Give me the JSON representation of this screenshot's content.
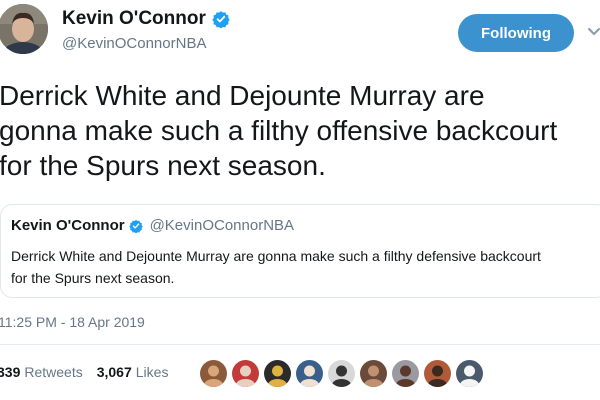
{
  "author": {
    "name": "Kevin O'Connor",
    "handle": "@KevinOConnorNBA",
    "verified": true,
    "avatar_icon": "profile-photo"
  },
  "follow_button": {
    "label": "Following"
  },
  "tweet": {
    "lines": [
      "Derrick White and Dejounte Murray are",
      "gonna make such a filthy offensive backcourt",
      "for the Spurs next season."
    ]
  },
  "quoted_tweet": {
    "name": "Kevin O'Connor",
    "handle": "@KevinOConnorNBA",
    "lines": [
      "Derrick White and Dejounte Murray are gonna make such a filthy defensive backcourt",
      "for the Spurs next season."
    ]
  },
  "timestamp": "11:25 PM - 18 Apr 2019",
  "stats": {
    "retweets_count": "339",
    "retweets_label": "Retweets",
    "likes_count": "3,067",
    "likes_label": "Likes"
  },
  "colors": {
    "accent": "#3b92cf",
    "verified": "#1da1f2",
    "secondary_text": "#657786",
    "border": "#e1e8ed"
  },
  "liker_avatars": [
    {
      "icon": "liker-avatar",
      "bg": "#8a5a3a",
      "fg": "#d9a679"
    },
    {
      "icon": "liker-avatar",
      "bg": "#c23a3a",
      "fg": "#e8d0c0"
    },
    {
      "icon": "liker-avatar",
      "bg": "#2b2b2b",
      "fg": "#e0b040"
    },
    {
      "icon": "liker-avatar",
      "bg": "#3a5f8a",
      "fg": "#f0e0d0"
    },
    {
      "icon": "liker-avatar",
      "bg": "#d8d8d8",
      "fg": "#333333"
    },
    {
      "icon": "liker-avatar",
      "bg": "#6a4a3a",
      "fg": "#c09070"
    },
    {
      "icon": "liker-avatar",
      "bg": "#9a9aa0",
      "fg": "#5a3a2a"
    },
    {
      "icon": "liker-avatar",
      "bg": "#b05a3a",
      "fg": "#3a2a20"
    },
    {
      "icon": "liker-avatar",
      "bg": "#4a5a6a",
      "fg": "#f4f4f4"
    }
  ]
}
